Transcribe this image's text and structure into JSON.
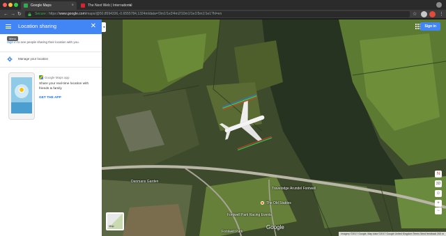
{
  "browser": {
    "tabs": [
      {
        "title": "Google Maps",
        "active": true,
        "favicon_color": "#34a853"
      },
      {
        "title": "The Next Web | International",
        "active": false,
        "favicon_color": "#d9232e"
      }
    ],
    "address": {
      "secure_label": "Secure",
      "scheme": "https://",
      "host": "www.google.com",
      "path": "/maps/@50.8594336,-0.6555784,1324m/data=!3m1!1e3!4m2!10m1!1e1!5m1!1e1?hl=en"
    }
  },
  "panel": {
    "title": "Location sharing",
    "menu_tooltip": "Menu",
    "signin_link": "Sign in",
    "signin_rest": " to see people sharing their location with you.",
    "manage_label": "Manage your location",
    "app_name": "Google Maps app",
    "promo_text": "Share your real-time location with friends & family",
    "get_app": "GET THE APP"
  },
  "map": {
    "signin_button": "Sign in",
    "thumbnail_label": "Map",
    "google_logo": "Google",
    "attribution": "Imagery ©2017 Google, Map data ©2017 Google   United Kingdom   Terms   Send feedback   200 m",
    "places": [
      {
        "name": "Denmans Garden"
      },
      {
        "name": "Fontwell Park Racing Events"
      },
      {
        "name": "Fontwell Park"
      },
      {
        "name": "The Old Stables"
      },
      {
        "name": "Travelodge Arundel Fontwell"
      }
    ],
    "controls": {
      "compass": "N",
      "tilt": "3D"
    }
  }
}
